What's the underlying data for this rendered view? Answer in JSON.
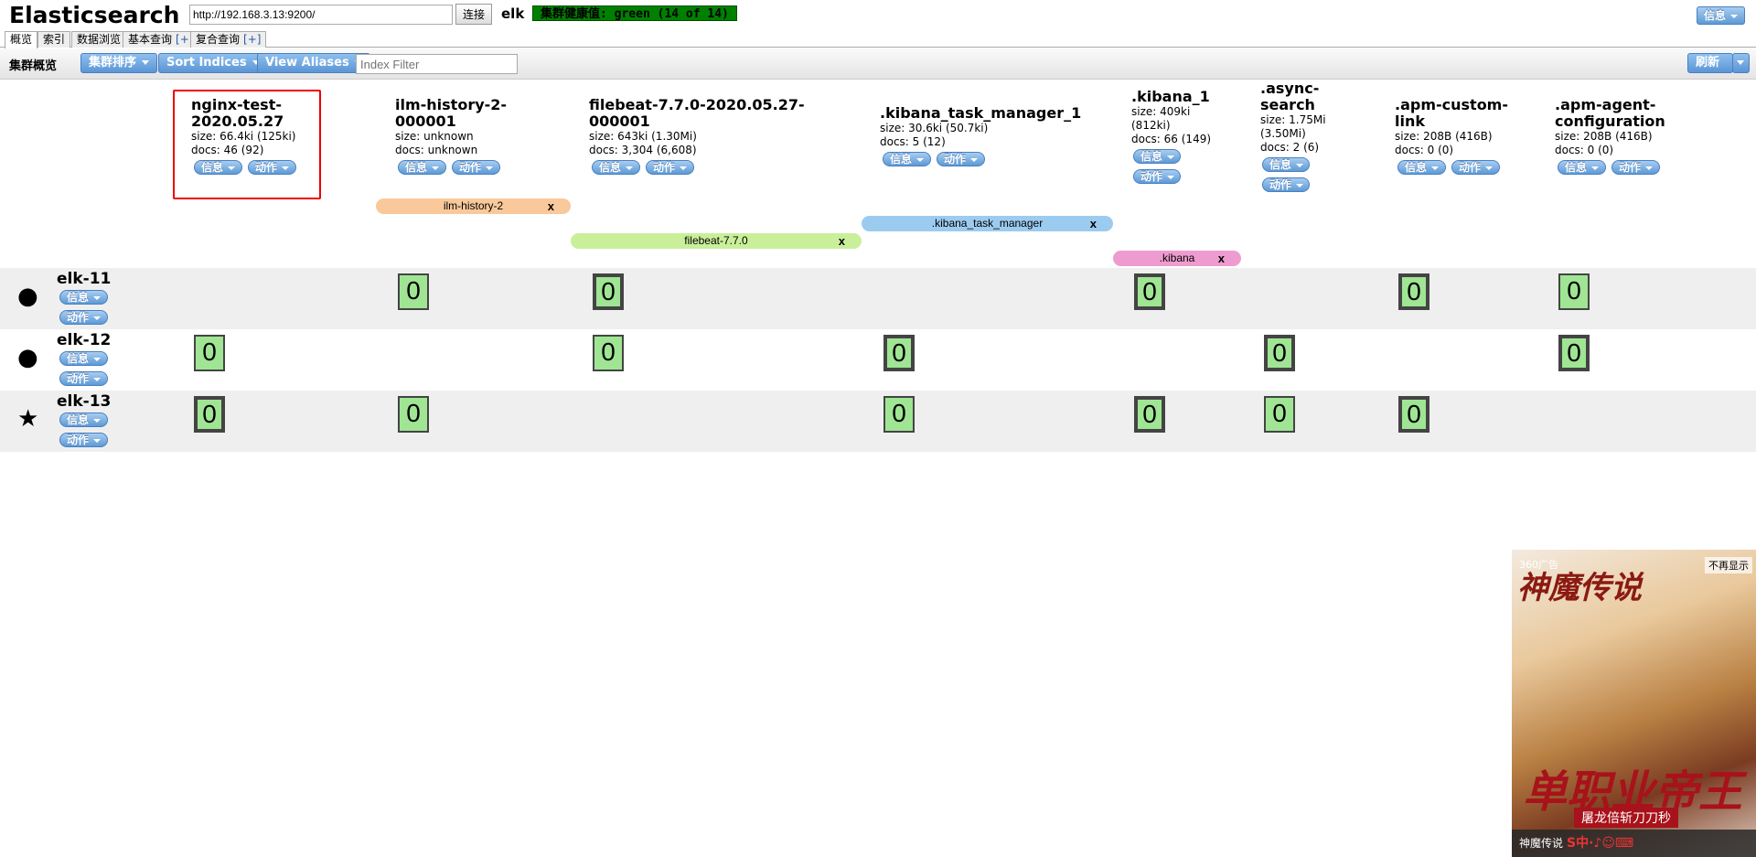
{
  "header": {
    "app_title": "Elasticsearch",
    "url_value": "http://192.168.3.13:9200/",
    "connect_label": "连接",
    "cluster_name": "elk",
    "health_text": "集群健康值: green (14 of 14)",
    "info_label": "信息"
  },
  "tabs": [
    {
      "label": "概览",
      "active": true
    },
    {
      "label": "索引"
    },
    {
      "label": "数据浏览"
    },
    {
      "label": "基本查询",
      "plus": "[+]"
    },
    {
      "label": "复合查询",
      "plus": "[+]"
    }
  ],
  "toolbar": {
    "overview_label": "集群概览",
    "sort_cluster": "集群排序",
    "sort_indices": "Sort Indices",
    "view_aliases": "View Aliases",
    "index_filter_placeholder": "Index Filter",
    "refresh_label": "刷新"
  },
  "buttons": {
    "info": "信息",
    "action": "动作"
  },
  "indices": [
    {
      "name": "nginx-test-2020.05.27",
      "size": "size: 66.4ki (125ki)",
      "docs": "docs: 46 (92)",
      "highlighted": true
    },
    {
      "name": "ilm-history-2-000001",
      "size": "size: unknown",
      "docs": "docs: unknown"
    },
    {
      "name": "filebeat-7.7.0-2020.05.27-000001",
      "size": "size: 643ki (1.30Mi)",
      "docs": "docs: 3,304 (6,608)"
    },
    {
      "name": ".kibana_task_manager_1",
      "size": "size: 30.6ki (50.7ki)",
      "docs": "docs: 5 (12)"
    },
    {
      "name": ".kibana_1",
      "size": "size: 409ki (812ki)",
      "docs": "docs: 66 (149)"
    },
    {
      "name": ".async-search",
      "size": "size: 1.75Mi (3.50Mi)",
      "docs": "docs: 2 (6)"
    },
    {
      "name": ".apm-custom-link",
      "size": "size: 208B (416B)",
      "docs": "docs: 0 (0)"
    },
    {
      "name": ".apm-agent-configuration",
      "size": "size: 208B (416B)",
      "docs": "docs: 0 (0)"
    }
  ],
  "aliases": [
    {
      "name": "ilm-history-2",
      "close": "x",
      "color": "#f9c99b"
    },
    {
      "name": "filebeat-7.7.0",
      "close": "x",
      "color": "#c9ef9a"
    },
    {
      "name": ".kibana_task_manager",
      "close": "x",
      "color": "#9ccbf0"
    },
    {
      "name": ".kibana",
      "close": "x",
      "color": "#ee9ccf"
    }
  ],
  "nodes": [
    {
      "name": "elk-11",
      "icon": "●",
      "icon_name": "circle-icon",
      "shards": [
        null,
        "0",
        "0",
        null,
        "0",
        null,
        "0",
        "0"
      ]
    },
    {
      "name": "elk-12",
      "icon": "●",
      "icon_name": "circle-icon",
      "shards": [
        "0",
        null,
        "0",
        "0",
        null,
        "0",
        null,
        "0"
      ]
    },
    {
      "name": "elk-13",
      "icon": "★",
      "icon_name": "star-icon",
      "shards": [
        "0",
        "0",
        null,
        "0",
        "0",
        "0",
        "0",
        null
      ]
    }
  ],
  "ad": {
    "badge": "360广告",
    "close": "不再显示",
    "title": "神魔传说",
    "slogan": "单职业帝王",
    "subtitle": "屠龙倍斩刀刀秒",
    "footer": "神魔传说",
    "ime": "S中·♪☺⌨"
  }
}
